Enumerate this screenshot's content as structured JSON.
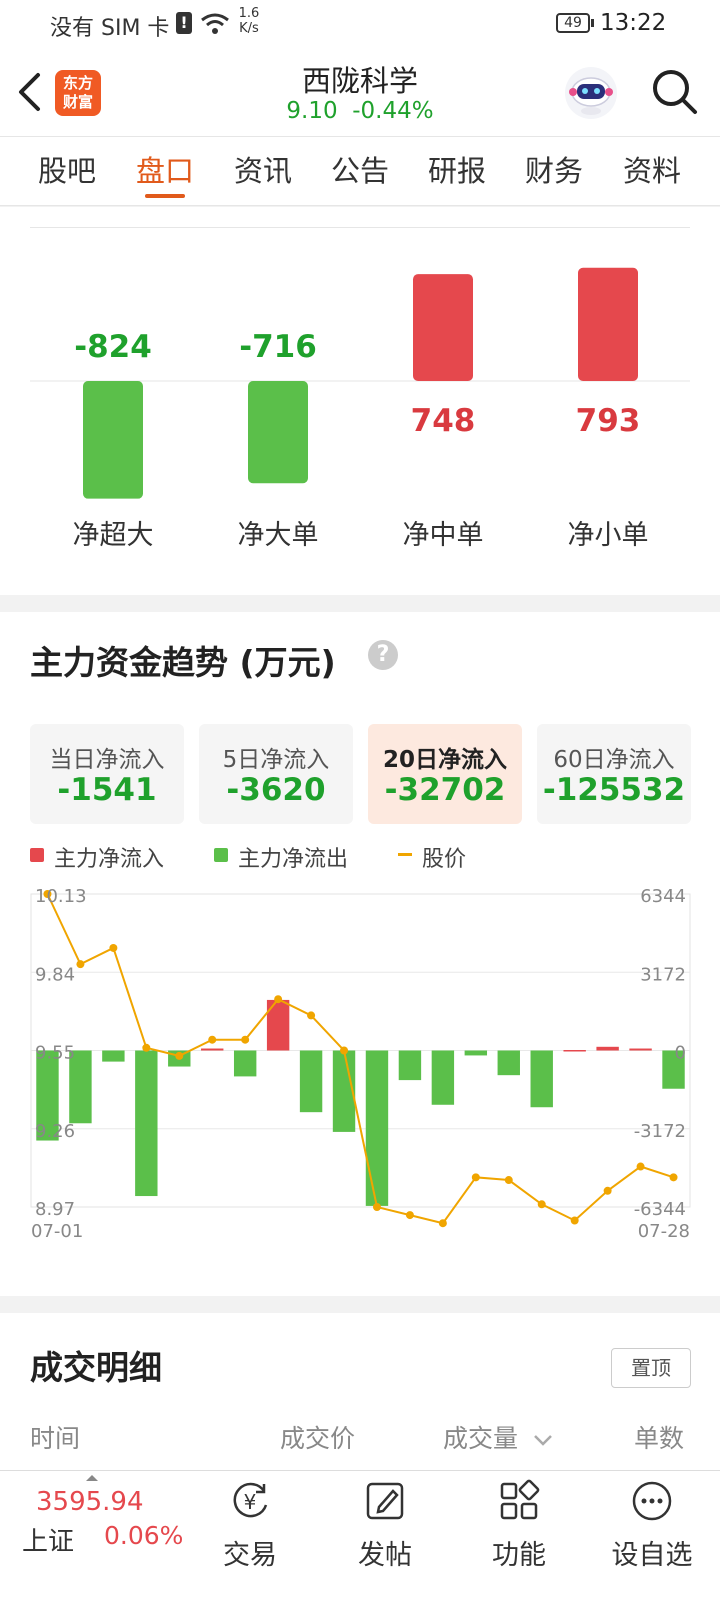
{
  "status_bar": {
    "sim": "没有 SIM 卡",
    "speed_top": "1.6",
    "speed_bottom": "K/s",
    "battery": "49",
    "time": "13:22"
  },
  "header": {
    "brand_line1": "东方",
    "brand_line2": "财富",
    "title": "西陇科学",
    "price": "9.10",
    "change": "-0.44%"
  },
  "tabs": [
    "股吧",
    "盘口",
    "资讯",
    "公告",
    "研报",
    "财务",
    "资料"
  ],
  "active_tab": 1,
  "flow_bars": {
    "items": [
      {
        "label": "净超大",
        "value": -824
      },
      {
        "label": "净大单",
        "value": -716
      },
      {
        "label": "净中单",
        "value": 748
      },
      {
        "label": "净小单",
        "value": 793
      }
    ],
    "colors": {
      "positive": "#e5484d",
      "negative": "#5bbf4a"
    }
  },
  "trend": {
    "title": "主力资金趋势 (万元)",
    "cards": [
      {
        "label": "当日净流入",
        "value": "-1541"
      },
      {
        "label": "5日净流入",
        "value": "-3620"
      },
      {
        "label": "20日净流入",
        "value": "-32702"
      },
      {
        "label": "60日净流入",
        "value": "-125532"
      }
    ],
    "selected_card": 2,
    "legend": {
      "inflow": "主力净流入",
      "outflow": "主力净流出",
      "price": "股价"
    }
  },
  "chart_data": {
    "type": "bar",
    "x_start": "07-01",
    "x_end": "07-28",
    "left_ticks": [
      "10.13",
      "9.84",
      "9.55",
      "9.26",
      "8.97"
    ],
    "right_ticks": [
      "6344",
      "3172",
      "0",
      "-3172",
      "-6344"
    ],
    "ylim_flow": [
      -6344,
      6344
    ],
    "ylim_price": [
      8.97,
      10.13
    ],
    "series": [
      {
        "name": "主力净流入/主力净流出",
        "values": [
          -3650,
          -2950,
          -450,
          -5900,
          -650,
          80,
          -1050,
          2050,
          -2500,
          -3300,
          -6300,
          -1200,
          -2200,
          -200,
          -1000,
          -2300,
          20,
          150,
          80,
          -1550
        ]
      },
      {
        "name": "股价",
        "values": [
          10.13,
          9.87,
          9.93,
          9.56,
          9.53,
          9.59,
          9.59,
          9.74,
          9.68,
          9.55,
          8.97,
          8.94,
          8.91,
          9.08,
          9.07,
          8.98,
          8.92,
          9.03,
          9.12,
          9.08
        ]
      }
    ],
    "colors": {
      "inflow": "#e5484d",
      "outflow": "#5bbf4a",
      "price": "#f0a500"
    }
  },
  "trades": {
    "title": "成交明细",
    "pin_button": "置顶",
    "columns": [
      "时间",
      "成交价",
      "成交量",
      "单数"
    ]
  },
  "bottom_bar": {
    "index_value": "3595.94",
    "index_name": "上证",
    "index_change": "0.06%",
    "items": [
      "交易",
      "发帖",
      "功能",
      "设自选"
    ]
  }
}
